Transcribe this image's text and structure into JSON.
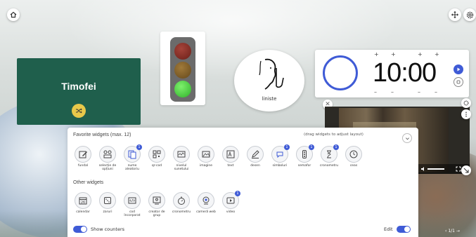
{
  "top_buttons": {
    "home_icon": "home-icon",
    "move_icon": "move-arrows-icon",
    "settings_icon": "gear-icon"
  },
  "name_picker": {
    "name": "Timofei",
    "bg_color": "#1f5f4c",
    "shuffle_color": "#e8c84a"
  },
  "traffic_light": {
    "active": "green",
    "colors": {
      "red": "#7a2a22",
      "amber": "#7a5a22",
      "green": "#45d63a"
    }
  },
  "quiet": {
    "label": "liniste"
  },
  "timer": {
    "display": "10:00",
    "plus": [
      "+",
      "+",
      "+",
      "+"
    ],
    "minus": [
      "–",
      "–",
      "–",
      "–"
    ],
    "accent": "#3f5bd6"
  },
  "panel": {
    "favorites_heading": "Favorite widgets (max. 12)",
    "drag_hint": "(drag widgets to adjust layout)",
    "favorites": [
      {
        "label": "fundal",
        "icon": "edit-background-icon"
      },
      {
        "label": "selecție de\nopțiuni",
        "icon": "selector-icon"
      },
      {
        "label": "nume\naleatoriu",
        "icon": "random-name-icon",
        "badge": "1"
      },
      {
        "label": "qr-cod",
        "icon": "qr-code-icon"
      },
      {
        "label": "nivelul\nsunetului",
        "icon": "sound-level-icon"
      },
      {
        "label": "imagine",
        "icon": "image-icon"
      },
      {
        "label": "text",
        "icon": "text-icon"
      },
      {
        "label": "desen",
        "icon": "pencil-icon"
      },
      {
        "label": "simboluri",
        "icon": "symbols-icon",
        "badge": "1"
      },
      {
        "label": "semafor",
        "icon": "traffic-light-icon",
        "badge": "1"
      },
      {
        "label": "cronometru",
        "icon": "hourglass-icon",
        "badge": "1"
      },
      {
        "label": "ceas",
        "icon": "clock-icon"
      }
    ],
    "other_heading": "Other widgets",
    "others": [
      {
        "label": "calendar",
        "icon": "calendar-icon",
        "day": "26"
      },
      {
        "label": "zaruri",
        "icon": "dice-icon"
      },
      {
        "label": "cod\nîncorporat",
        "icon": "embed-code-icon"
      },
      {
        "label": "creator de\ngrup",
        "icon": "group-maker-icon"
      },
      {
        "label": "cronometru",
        "icon": "stopwatch-icon"
      },
      {
        "label": "cameră web",
        "icon": "webcam-icon"
      },
      {
        "label": "video",
        "icon": "video-icon",
        "badge": "1"
      }
    ],
    "show_counters": "Show counters",
    "edit": "Edit"
  },
  "pager": "1/1"
}
